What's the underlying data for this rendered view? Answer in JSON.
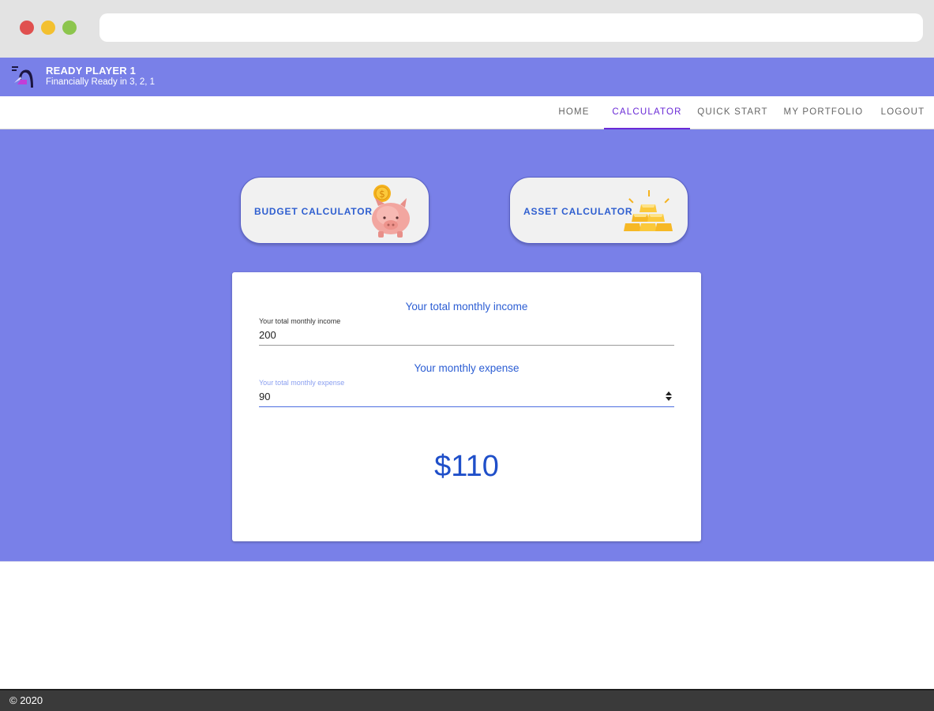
{
  "app": {
    "title": "READY PLAYER 1",
    "subtitle": "Financially Ready in 3, 2, 1"
  },
  "nav": {
    "items": [
      {
        "label": "HOME",
        "active": false
      },
      {
        "label": "CALCULATOR",
        "active": true
      },
      {
        "label": "QUICK START",
        "active": false
      },
      {
        "label": "MY PORTFOLIO",
        "active": false
      },
      {
        "label": "LOGOUT",
        "active": false
      }
    ]
  },
  "buttons": {
    "budget_label": "BUDGET CALCULATOR",
    "asset_label": "ASSET CALCULATOR"
  },
  "budget_form": {
    "income_title": "Your total monthly income",
    "income_label": "Your total monthly income",
    "income_value": "200",
    "expense_title": "Your monthly expense",
    "expense_label": "Your total monthly expense",
    "expense_value": "90",
    "result": "$110"
  },
  "footer": {
    "copyright": "© 2020"
  },
  "colors": {
    "brand": "#7980e8",
    "nav_active": "#6a2ad6",
    "accent_text": "#2c5ed4",
    "footer": "#3a3a3a"
  },
  "icons": [
    "logo-icon",
    "piggy-bank-icon",
    "coin-icon",
    "gold-bars-icon",
    "spinner-icon"
  ]
}
